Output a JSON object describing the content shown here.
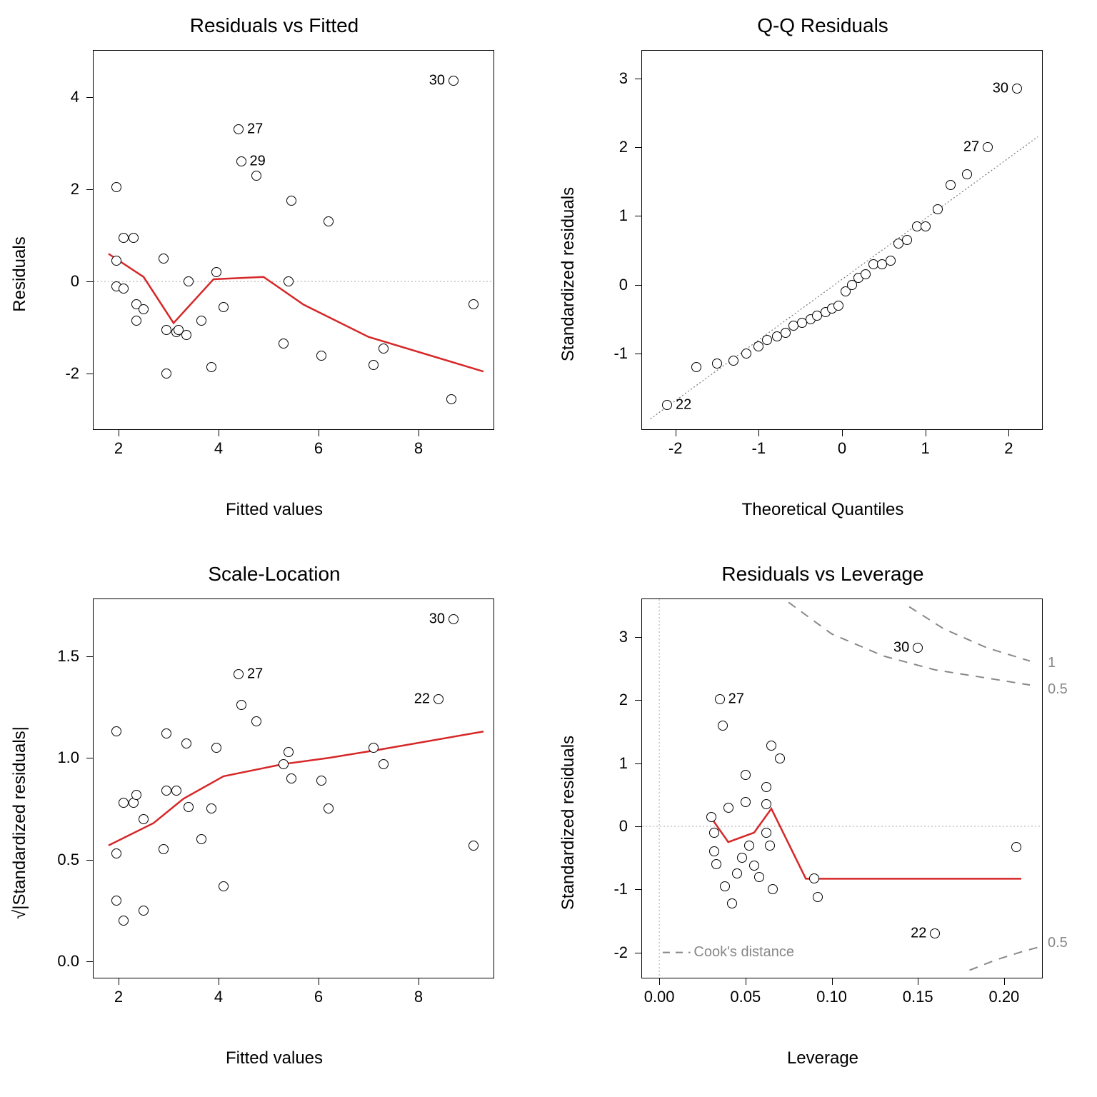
{
  "chart_data": [
    {
      "id": "residuals_vs_fitted",
      "type": "scatter",
      "title": "Residuals vs Fitted",
      "xlabel": "Fitted values",
      "ylabel": "Residuals",
      "xlim": [
        1.5,
        9.5
      ],
      "ylim": [
        -3.2,
        5.0
      ],
      "xticks": [
        2,
        4,
        6,
        8
      ],
      "yticks": [
        -2,
        0,
        2,
        4
      ],
      "points": [
        [
          1.95,
          2.05
        ],
        [
          1.95,
          0.45
        ],
        [
          1.95,
          -0.1
        ],
        [
          2.1,
          -0.15
        ],
        [
          2.1,
          0.95
        ],
        [
          2.3,
          0.95
        ],
        [
          2.35,
          -0.5
        ],
        [
          2.35,
          -0.85
        ],
        [
          2.5,
          -0.6
        ],
        [
          2.95,
          -2.0
        ],
        [
          2.9,
          0.5
        ],
        [
          2.95,
          -1.05
        ],
        [
          3.15,
          -1.1
        ],
        [
          3.2,
          -1.05
        ],
        [
          3.35,
          -1.15
        ],
        [
          3.4,
          0.0
        ],
        [
          3.65,
          -0.85
        ],
        [
          3.85,
          -1.85
        ],
        [
          3.95,
          0.2
        ],
        [
          4.1,
          -0.55
        ],
        [
          4.4,
          3.3
        ],
        [
          4.45,
          2.6
        ],
        [
          4.75,
          2.3
        ],
        [
          5.3,
          -1.35
        ],
        [
          5.4,
          0.0
        ],
        [
          5.45,
          1.75
        ],
        [
          6.05,
          -1.6
        ],
        [
          6.2,
          1.3
        ],
        [
          7.1,
          -1.8
        ],
        [
          7.3,
          -1.45
        ],
        [
          8.7,
          4.35
        ],
        [
          8.65,
          -2.55
        ],
        [
          9.1,
          -0.5
        ]
      ],
      "labeled_points": [
        {
          "label": "30",
          "x": 8.7,
          "y": 4.35,
          "side": "left"
        },
        {
          "label": "27",
          "x": 4.4,
          "y": 3.3,
          "side": "right"
        },
        {
          "label": "29",
          "x": 4.45,
          "y": 2.6,
          "side": "right"
        }
      ],
      "smoother": [
        [
          1.8,
          0.6
        ],
        [
          2.5,
          0.1
        ],
        [
          3.1,
          -0.9
        ],
        [
          3.9,
          0.05
        ],
        [
          4.9,
          0.1
        ],
        [
          5.7,
          -0.5
        ],
        [
          7.0,
          -1.2
        ],
        [
          9.3,
          -1.95
        ]
      ],
      "hline": 0
    },
    {
      "id": "qq_residuals",
      "type": "scatter",
      "title": "Q-Q Residuals",
      "xlabel": "Theoretical Quantiles",
      "ylabel": "Standardized residuals",
      "xlim": [
        -2.4,
        2.4
      ],
      "ylim": [
        -2.1,
        3.4
      ],
      "xticks": [
        -2,
        -1,
        0,
        1,
        2
      ],
      "yticks": [
        -1,
        0,
        1,
        2,
        3
      ],
      "points": [
        [
          -2.1,
          -1.75
        ],
        [
          -1.75,
          -1.2
        ],
        [
          -1.5,
          -1.15
        ],
        [
          -1.3,
          -1.1
        ],
        [
          -1.15,
          -1.0
        ],
        [
          -1.0,
          -0.9
        ],
        [
          -0.9,
          -0.8
        ],
        [
          -0.78,
          -0.75
        ],
        [
          -0.68,
          -0.7
        ],
        [
          -0.58,
          -0.6
        ],
        [
          -0.48,
          -0.55
        ],
        [
          -0.38,
          -0.5
        ],
        [
          -0.3,
          -0.45
        ],
        [
          -0.2,
          -0.4
        ],
        [
          -0.12,
          -0.35
        ],
        [
          -0.04,
          -0.3
        ],
        [
          0.04,
          -0.1
        ],
        [
          0.12,
          0.0
        ],
        [
          0.2,
          0.1
        ],
        [
          0.28,
          0.15
        ],
        [
          0.38,
          0.3
        ],
        [
          0.48,
          0.3
        ],
        [
          0.58,
          0.35
        ],
        [
          0.68,
          0.6
        ],
        [
          0.78,
          0.65
        ],
        [
          0.9,
          0.85
        ],
        [
          1.0,
          0.85
        ],
        [
          1.15,
          1.1
        ],
        [
          1.3,
          1.45
        ],
        [
          1.5,
          1.6
        ],
        [
          1.75,
          2.0
        ],
        [
          2.1,
          2.85
        ]
      ],
      "labeled_points": [
        {
          "label": "30",
          "x": 2.1,
          "y": 2.85,
          "side": "left"
        },
        {
          "label": "27",
          "x": 1.75,
          "y": 2.0,
          "side": "left"
        },
        {
          "label": "22",
          "x": -2.1,
          "y": -1.75,
          "side": "right"
        }
      ],
      "qqline": {
        "x1": -2.3,
        "y1": -1.95,
        "x2": 2.35,
        "y2": 2.15
      }
    },
    {
      "id": "scale_location",
      "type": "scatter",
      "title": "Scale-Location",
      "xlabel": "Fitted values",
      "ylabel": "√|Standardized residuals|",
      "xlim": [
        1.5,
        9.5
      ],
      "ylim": [
        -0.08,
        1.78
      ],
      "xticks": [
        2,
        4,
        6,
        8
      ],
      "yticks": [
        0.0,
        0.5,
        1.0,
        1.5
      ],
      "yticklabels": [
        "0.0",
        "0.5",
        "1.0",
        "1.5"
      ],
      "points": [
        [
          1.95,
          1.13
        ],
        [
          1.95,
          0.53
        ],
        [
          1.95,
          0.3
        ],
        [
          2.1,
          0.78
        ],
        [
          2.1,
          0.2
        ],
        [
          2.3,
          0.78
        ],
        [
          2.35,
          0.82
        ],
        [
          2.5,
          0.7
        ],
        [
          2.5,
          0.25
        ],
        [
          2.9,
          0.55
        ],
        [
          2.95,
          1.12
        ],
        [
          2.95,
          0.84
        ],
        [
          3.15,
          0.84
        ],
        [
          3.35,
          1.07
        ],
        [
          3.4,
          0.76
        ],
        [
          3.65,
          0.6
        ],
        [
          3.85,
          0.75
        ],
        [
          3.95,
          1.05
        ],
        [
          4.1,
          0.37
        ],
        [
          4.4,
          1.41
        ],
        [
          4.45,
          1.26
        ],
        [
          4.75,
          1.18
        ],
        [
          5.3,
          0.97
        ],
        [
          5.4,
          1.03
        ],
        [
          5.45,
          0.9
        ],
        [
          6.05,
          0.89
        ],
        [
          6.2,
          0.75
        ],
        [
          7.1,
          1.05
        ],
        [
          7.3,
          0.97
        ],
        [
          8.4,
          1.29
        ],
        [
          8.7,
          1.68
        ],
        [
          9.1,
          0.57
        ]
      ],
      "labeled_points": [
        {
          "label": "30",
          "x": 8.7,
          "y": 1.68,
          "side": "left"
        },
        {
          "label": "27",
          "x": 4.4,
          "y": 1.41,
          "side": "right"
        },
        {
          "label": "22",
          "x": 8.4,
          "y": 1.29,
          "side": "left"
        }
      ],
      "smoother": [
        [
          1.8,
          0.57
        ],
        [
          2.7,
          0.68
        ],
        [
          3.3,
          0.8
        ],
        [
          4.1,
          0.91
        ],
        [
          5.3,
          0.97
        ],
        [
          6.2,
          1.0
        ],
        [
          7.2,
          1.04
        ],
        [
          9.3,
          1.13
        ]
      ]
    },
    {
      "id": "residuals_vs_leverage",
      "type": "scatter",
      "title": "Residuals vs Leverage",
      "xlabel": "Leverage",
      "ylabel": "Standardized residuals",
      "xlim": [
        -0.01,
        0.222
      ],
      "ylim": [
        -2.4,
        3.6
      ],
      "xticks": [
        0.0,
        0.05,
        0.1,
        0.15,
        0.2
      ],
      "xticklabels": [
        "0.00",
        "0.05",
        "0.10",
        "0.15",
        "0.20"
      ],
      "yticks": [
        -2,
        -1,
        0,
        1,
        2,
        3
      ],
      "points": [
        [
          0.03,
          0.15
        ],
        [
          0.032,
          -0.4
        ],
        [
          0.033,
          -0.6
        ],
        [
          0.032,
          -0.1
        ],
        [
          0.035,
          2.02
        ],
        [
          0.037,
          1.6
        ],
        [
          0.04,
          0.3
        ],
        [
          0.038,
          -0.95
        ],
        [
          0.042,
          -1.22
        ],
        [
          0.045,
          -0.75
        ],
        [
          0.048,
          -0.5
        ],
        [
          0.05,
          0.82
        ],
        [
          0.05,
          0.38
        ],
        [
          0.052,
          -0.3
        ],
        [
          0.055,
          -0.62
        ],
        [
          0.058,
          -0.8
        ],
        [
          0.062,
          0.62
        ],
        [
          0.062,
          0.35
        ],
        [
          0.062,
          -0.1
        ],
        [
          0.064,
          -0.3
        ],
        [
          0.065,
          1.28
        ],
        [
          0.066,
          -1.0
        ],
        [
          0.07,
          1.08
        ],
        [
          0.09,
          -0.83
        ],
        [
          0.092,
          -1.12
        ],
        [
          0.15,
          2.83
        ],
        [
          0.16,
          -1.7
        ],
        [
          0.207,
          -0.33
        ]
      ],
      "labeled_points": [
        {
          "label": "30",
          "x": 0.15,
          "y": 2.83,
          "side": "left"
        },
        {
          "label": "27",
          "x": 0.035,
          "y": 2.02,
          "side": "right"
        },
        {
          "label": "22",
          "x": 0.16,
          "y": -1.7,
          "side": "left"
        }
      ],
      "smoother": [
        [
          0.03,
          0.14
        ],
        [
          0.04,
          -0.25
        ],
        [
          0.055,
          -0.1
        ],
        [
          0.065,
          0.28
        ],
        [
          0.085,
          -0.83
        ],
        [
          0.09,
          -0.83
        ],
        [
          0.21,
          -0.83
        ]
      ],
      "hline": 0,
      "vline": 0,
      "cooks_label": "Cook's distance",
      "cooks_curves": {
        "top": [
          [
            0.075,
            3.55
          ],
          [
            0.1,
            3.05
          ],
          [
            0.13,
            2.7
          ],
          [
            0.16,
            2.48
          ],
          [
            0.19,
            2.35
          ],
          [
            0.215,
            2.24
          ]
        ],
        "top_half": [
          [
            0.145,
            3.48
          ],
          [
            0.165,
            3.13
          ],
          [
            0.19,
            2.83
          ],
          [
            0.215,
            2.62
          ]
        ],
        "bot_half": [
          [
            0.18,
            -2.28
          ],
          [
            0.195,
            -2.12
          ],
          [
            0.21,
            -1.99
          ],
          [
            0.222,
            -1.9
          ]
        ]
      },
      "contour_labels": [
        {
          "label": "1",
          "x": 0.222,
          "y": 2.58
        },
        {
          "label": "0.5",
          "x": 0.222,
          "y": 2.16
        },
        {
          "label": "0.5",
          "x": 0.222,
          "y": -1.86
        }
      ]
    }
  ]
}
